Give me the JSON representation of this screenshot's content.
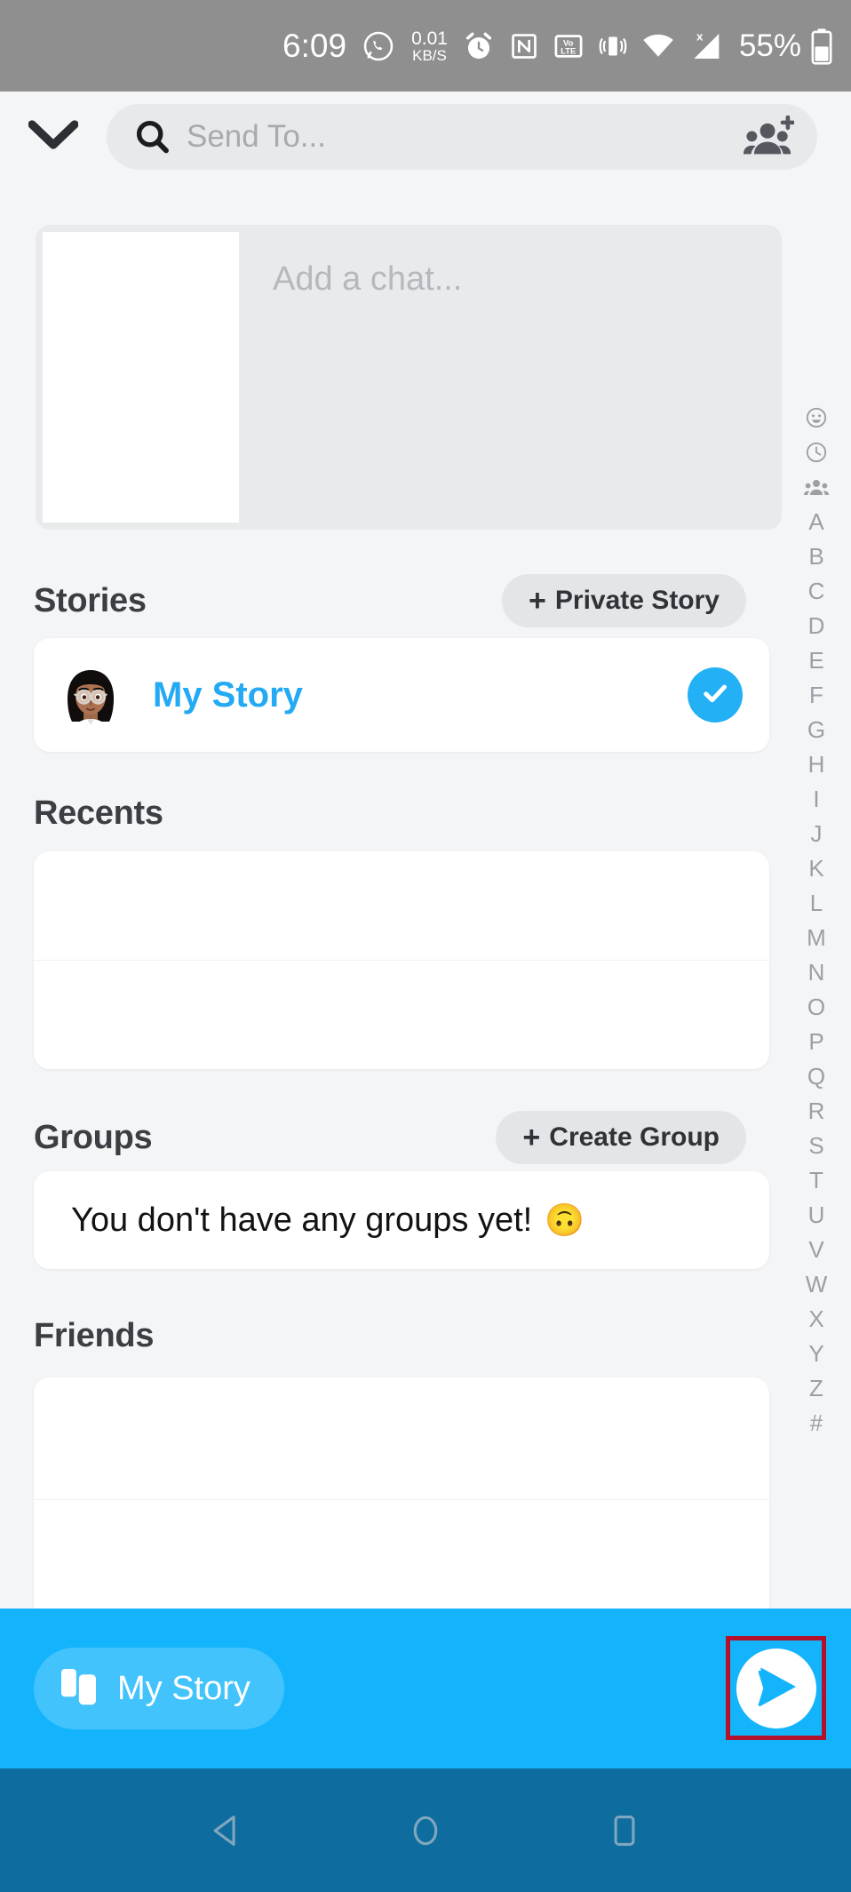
{
  "status_bar": {
    "time": "6:09",
    "whatsapp_icon": "whatsapp-icon",
    "data_rate_value": "0.01",
    "data_rate_unit": "KB/S",
    "alarm_icon": "alarm-clock-icon",
    "nfc_icon": "nfc-icon",
    "volte_top": "Vo",
    "volte_bottom": "LTE",
    "vibrate_icon": "vibrate-icon",
    "wifi_icon": "wifi-icon",
    "signal_icon": "no-signal-icon",
    "battery_percent": "55%",
    "battery_icon": "battery-icon",
    "background_color": "#8f8f8f",
    "text_color": "#ffffff"
  },
  "topbar": {
    "back_icon": "chevron-down-icon",
    "search_icon": "search-icon",
    "search_placeholder": "Send To...",
    "search_value": "",
    "add_friends_icon": "add-friends-icon"
  },
  "preview": {
    "thumbnail_label": "snap-preview-thumbnail",
    "caption_placeholder": "Add a chat..."
  },
  "sections": {
    "stories": {
      "title": "Stories",
      "action_plus": "+",
      "action_label": "Private Story"
    },
    "recents": {
      "title": "Recents"
    },
    "groups": {
      "title": "Groups",
      "action_plus": "+",
      "action_label": "Create Group",
      "empty_text": "You don't have any groups yet!",
      "empty_emoji": "🙃"
    },
    "friends": {
      "title": "Friends"
    }
  },
  "my_story_row": {
    "avatar_icon": "bitmoji-avatar",
    "label": "My Story",
    "selected": true,
    "check_icon": "check-icon",
    "accent_color": "#24aaf2"
  },
  "alpha_index": {
    "icons": [
      "bitmoji-smiley-icon",
      "clock-icon",
      "group-icon"
    ],
    "letters": [
      "A",
      "B",
      "C",
      "D",
      "E",
      "F",
      "G",
      "H",
      "I",
      "J",
      "K",
      "L",
      "M",
      "N",
      "O",
      "P",
      "Q",
      "R",
      "S",
      "T",
      "U",
      "V",
      "W",
      "X",
      "Y",
      "Z",
      "#"
    ]
  },
  "bottom_bar": {
    "background_color": "#14b4fc",
    "chip_icon": "story-cards-icon",
    "chip_label": "My Story",
    "send_icon": "send-arrow-icon",
    "highlight_color": "#b3112b",
    "highlight_target": "send-button"
  },
  "nav_bar": {
    "background_color": "#0e6d9e",
    "back_icon": "triangle-back-icon",
    "home_icon": "circle-home-icon",
    "recents_icon": "square-recents-icon"
  }
}
